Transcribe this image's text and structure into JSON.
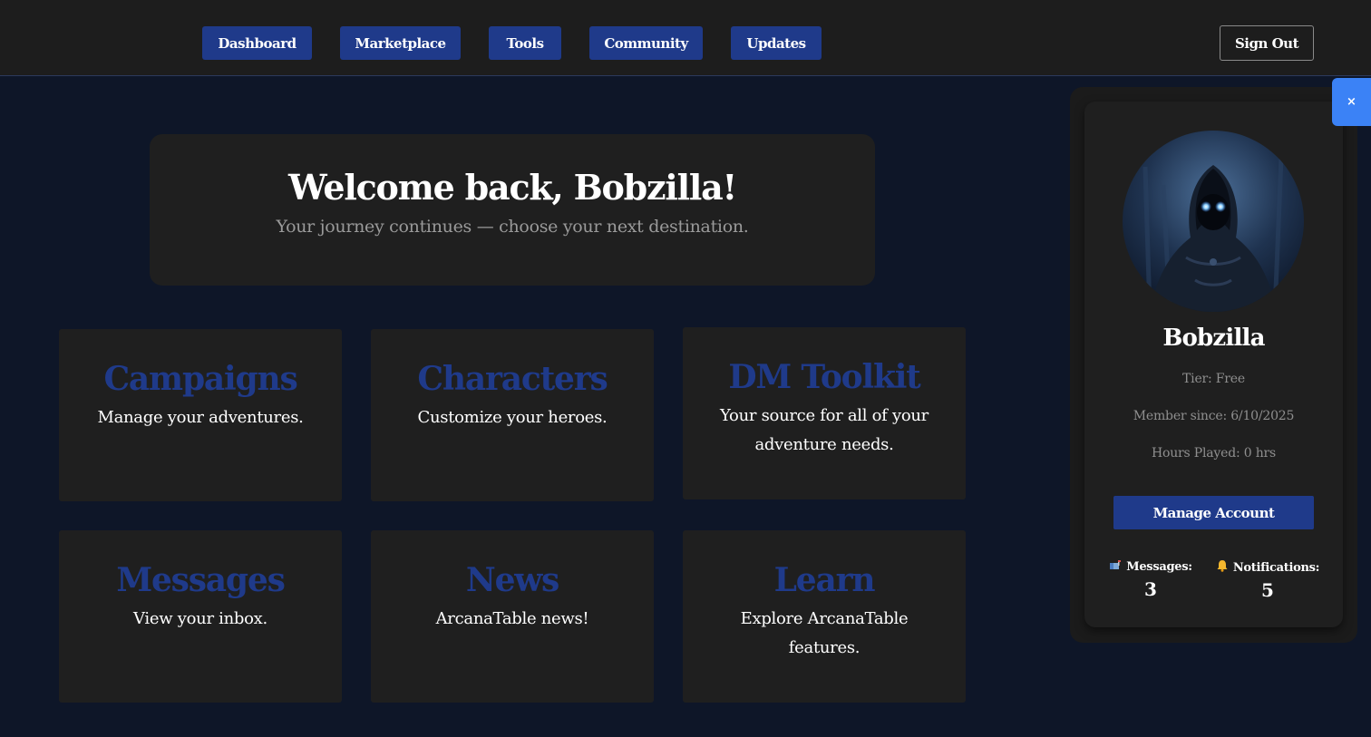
{
  "nav": {
    "items": [
      {
        "label": "Dashboard"
      },
      {
        "label": "Marketplace"
      },
      {
        "label": "Tools"
      },
      {
        "label": "Community"
      },
      {
        "label": "Updates"
      }
    ],
    "sign_out": "Sign Out"
  },
  "welcome": {
    "title": "Welcome back, Bobzilla!",
    "subtitle": "Your journey continues — choose your next destination."
  },
  "cards": [
    {
      "title": "Campaigns",
      "desc": "Manage your adventures."
    },
    {
      "title": "Characters",
      "desc": "Customize your heroes."
    },
    {
      "title": "DM Toolkit",
      "desc": "Your source for all of your adventure needs."
    },
    {
      "title": "Messages",
      "desc": "View your inbox."
    },
    {
      "title": "News",
      "desc": "ArcanaTable news!"
    },
    {
      "title": "Learn",
      "desc": "Explore ArcanaTable features."
    }
  ],
  "profile": {
    "close": "×",
    "name": "Bobzilla",
    "tier": "Tier: Free",
    "member_since": "Member since: 6/10/2025",
    "hours": "Hours Played: 0 hrs",
    "manage_label": "Manage Account",
    "messages_label": "Messages:",
    "messages_count": "3",
    "notifications_label": "Notifications:",
    "notifications_count": "5"
  },
  "colors": {
    "accent": "#1f3a8a",
    "close_tab": "#3b82f6",
    "background": "#0e1628",
    "surface": "#1f1f1f"
  }
}
